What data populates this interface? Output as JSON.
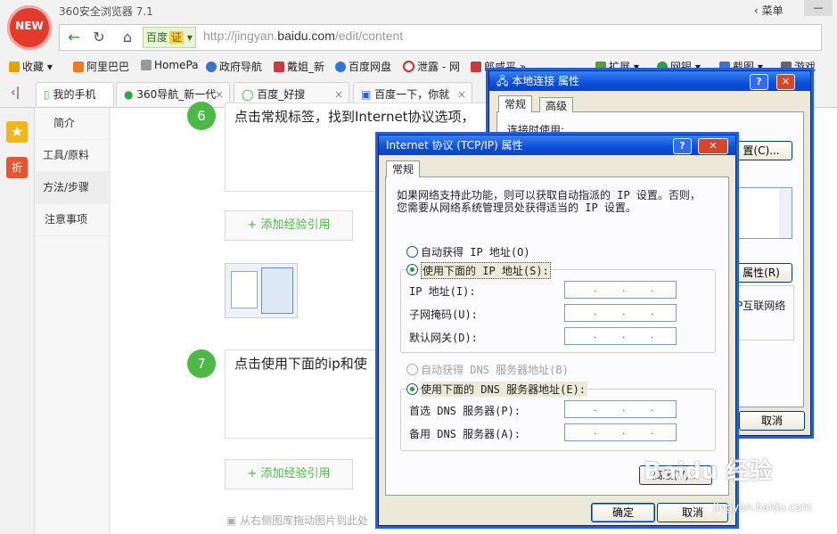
{
  "browser": {
    "app_title": "360安全浏览器 7.1",
    "logo_text": "NEW",
    "menu_label": "菜单",
    "search_engine": "百度",
    "search_engine_badge": "证",
    "url_prefix": "http://jingyan.",
    "url_domain": "baidu.com",
    "url_path": "/edit/content"
  },
  "bookmarks": [
    {
      "label": "收藏",
      "icon": "star-plus-icon",
      "color": "#e5a100"
    },
    {
      "label": "阿里巴巴",
      "icon": "alibaba-icon",
      "color": "#f07a1a"
    },
    {
      "label": "HomePa",
      "icon": "page-icon",
      "color": "#9a9a9a"
    },
    {
      "label": "政府导航",
      "icon": "globe-search-icon",
      "color": "#3a73c8"
    },
    {
      "label": "戴姐_新",
      "icon": "game-icon",
      "color": "#c63b3b"
    },
    {
      "label": "百度网盘",
      "icon": "cloud-icon",
      "color": "#2b78e4"
    },
    {
      "label": "泄露 - 网",
      "icon": "circle-icon",
      "color": "#d22a2a"
    },
    {
      "label": "郎咸平",
      "icon": "game-icon",
      "color": "#c63b3b"
    },
    {
      "label": "扩展",
      "icon": "puzzle-icon",
      "color": "#5aa02c"
    },
    {
      "label": "网银",
      "icon": "shield-icon",
      "color": "#2f9e44"
    },
    {
      "label": "截图",
      "icon": "scissors-icon",
      "color": "#3a73c8"
    },
    {
      "label": "游戏",
      "icon": "gamepad-icon",
      "color": "#666666"
    }
  ],
  "tabs": [
    {
      "label": "我的手机"
    },
    {
      "label": "360导航_新一代"
    },
    {
      "label": "百度_好搜"
    },
    {
      "label": "百度一下，你就"
    }
  ],
  "sidebar": {
    "items": [
      "简介",
      "工具/原料",
      "方法/步骤",
      "注意事项"
    ],
    "zhe_label": "折"
  },
  "content": {
    "step6_number": "6",
    "step6_text": "点击常规标签，找到Internet协议选项，",
    "step7_number": "7",
    "step7_text": "点击使用下面的ip和使",
    "add_ref_label": "+ 添加经验引用",
    "drag_tip": "从右侧图库拖动图片到此处"
  },
  "lan_dialog": {
    "title": "本地连接 属性",
    "tab_general": "常规",
    "tab_advanced": "高级",
    "connect_using": "连接时使用:",
    "configure_btn": "置(C)...",
    "properties_btn": "属性(R)",
    "desc_fragment": "P互联网络",
    "cancel_btn": "取消"
  },
  "tcp_dialog": {
    "title": "Internet 协议 (TCP/IP) 属性",
    "tab_general": "常规",
    "intro_line1": "如果网络支持此功能，则可以获取自动指派的 IP 设置。否则，",
    "intro_line2": "您需要从网络系统管理员处获得适当的 IP 设置。",
    "auto_ip": "自动获得 IP 地址(O)",
    "manual_ip": "使用下面的 IP 地址(S):",
    "ip_label": "IP 地址(I):",
    "mask_label": "子网掩码(U):",
    "gateway_label": "默认网关(D):",
    "auto_dns": "自动获得 DNS 服务器地址(B)",
    "manual_dns": "使用下面的 DNS 服务器地址(E):",
    "dns1_label": "首选 DNS 服务器(P):",
    "dns2_label": "备用 DNS 服务器(A):",
    "advanced_btn": "高级(V)...",
    "ok_btn": "确定",
    "cancel_btn": "取消",
    "ip_placeholder": ".   .   ."
  },
  "watermark": {
    "brand": "Baidu 经验",
    "sub": "jingyan.baidu.com"
  }
}
